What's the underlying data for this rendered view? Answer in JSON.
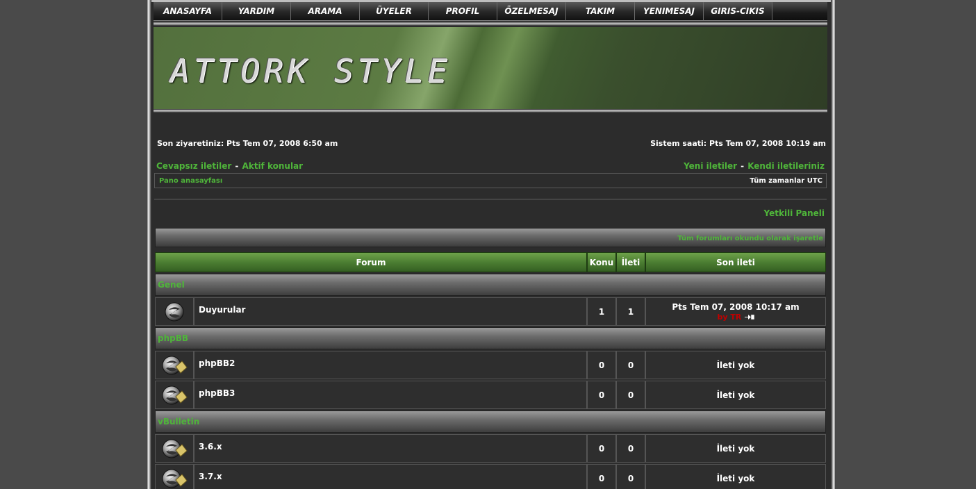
{
  "nav": {
    "items": [
      {
        "label": "ANASAYFA"
      },
      {
        "label": "YARDIM"
      },
      {
        "label": "ARAMA"
      },
      {
        "label": "ÜYELER"
      },
      {
        "label": "PROFIL"
      },
      {
        "label": "ÖZELMESAJ"
      },
      {
        "label": "TAKIM"
      },
      {
        "label": "YENIMESAJ"
      },
      {
        "label": "GIRIS-CIKIS"
      }
    ]
  },
  "banner": {
    "title": "ATTORK STYLE"
  },
  "info": {
    "last_visit": "Son ziyaretiniz: Pts Tem 07, 2008 6:50 am",
    "system_time": "Sistem saati: Pts Tem 07, 2008 10:19 am"
  },
  "links": {
    "unanswered": "Cevapsız iletiler",
    "active": "Aktif konular",
    "new_posts": "Yeni iletiler",
    "own_posts": "Kendi iletileriniz",
    "dash": "-"
  },
  "breadcrumb": {
    "home": "Pano anasayfası",
    "timezone": "Tüm zamanlar UTC"
  },
  "admin_panel": "Yetkili Paneli",
  "mark_read": "Tüm forumları okundu olarak işaretle",
  "table": {
    "headers": {
      "forum": "Forum",
      "topics": "Konu",
      "posts": "İleti",
      "last_post": "Son ileti"
    },
    "categories": [
      {
        "name": "Genel",
        "forums": [
          {
            "name": "Duyurular",
            "topics": "1",
            "posts": "1",
            "last_date": "Pts Tem 07, 2008 10:17 am",
            "last_by": "by TR",
            "icon": "forum-read-icon"
          }
        ]
      },
      {
        "name": "phpBB",
        "forums": [
          {
            "name": "phpBB2",
            "topics": "0",
            "posts": "0",
            "last": "İleti yok",
            "icon": "forum-locked-icon"
          },
          {
            "name": "phpBB3",
            "topics": "0",
            "posts": "0",
            "last": "İleti yok",
            "icon": "forum-locked-icon"
          }
        ]
      },
      {
        "name": "vBulletin",
        "forums": [
          {
            "name": "3.6.x",
            "topics": "0",
            "posts": "0",
            "last": "İleti yok",
            "icon": "forum-locked-icon"
          },
          {
            "name": "3.7.x",
            "topics": "0",
            "posts": "0",
            "last": "İleti yok",
            "icon": "forum-locked-icon"
          }
        ]
      }
    ]
  },
  "colors": {
    "accent": "#4fb53a",
    "header_green": "#4c7e32",
    "background": "#2c2c2c"
  }
}
